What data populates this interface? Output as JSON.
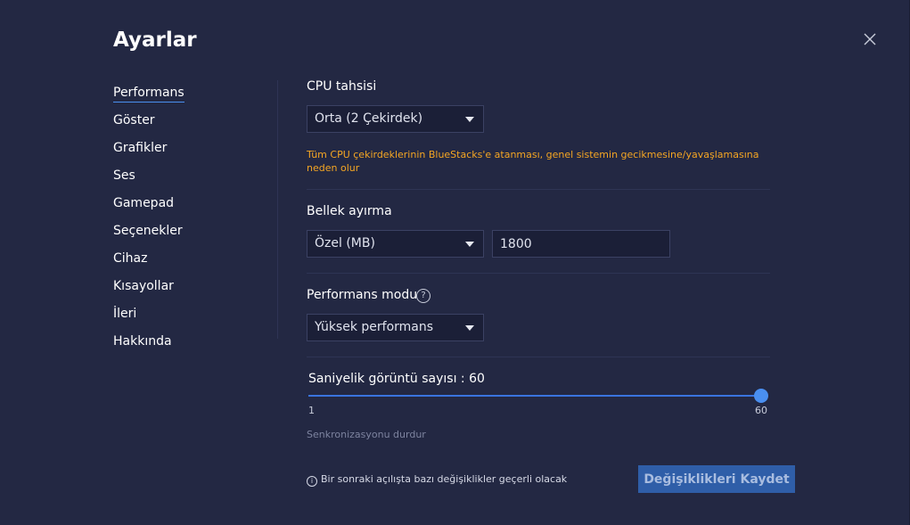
{
  "page": {
    "title": "Ayarlar"
  },
  "icons": {
    "close": "close-icon",
    "help": "help-icon",
    "info": "info-icon",
    "dropdown": "caret-down-icon"
  },
  "sidebar": {
    "items": [
      {
        "label": "Performans",
        "active": true
      },
      {
        "label": "Göster"
      },
      {
        "label": "Grafikler"
      },
      {
        "label": "Ses"
      },
      {
        "label": "Gamepad"
      },
      {
        "label": "Seçenekler"
      },
      {
        "label": "Cihaz"
      },
      {
        "label": "Kısayollar"
      },
      {
        "label": "İleri"
      },
      {
        "label": "Hakkında"
      }
    ]
  },
  "cpu": {
    "label": "CPU tahsisi",
    "selected": "Orta (2 Çekirdek)",
    "warning": "Tüm CPU çekirdeklerinin BlueStacks'e atanması, genel sistemin gecikmesine/yavaşlamasına neden olur"
  },
  "memory": {
    "label": "Bellek ayırma",
    "selected": "Özel (MB)",
    "value": "1800"
  },
  "performance_mode": {
    "label": "Performans modu",
    "help": "?",
    "selected": "Yüksek performans"
  },
  "fps": {
    "label": "Saniyelik görüntü sayısı : 60",
    "min": "1",
    "max": "60",
    "value": 60,
    "vsync_label": "Senkronizasyonu durdur"
  },
  "footer": {
    "info_glyph": "i",
    "note": "Bir sonraki açılışta bazı değişiklikler geçerli olacak",
    "save_label": "Değişiklikleri Kaydet"
  },
  "colors": {
    "background": "#232843",
    "accent": "#4a8ff0",
    "warning": "#f5a623",
    "button": "#2f5ea8"
  }
}
